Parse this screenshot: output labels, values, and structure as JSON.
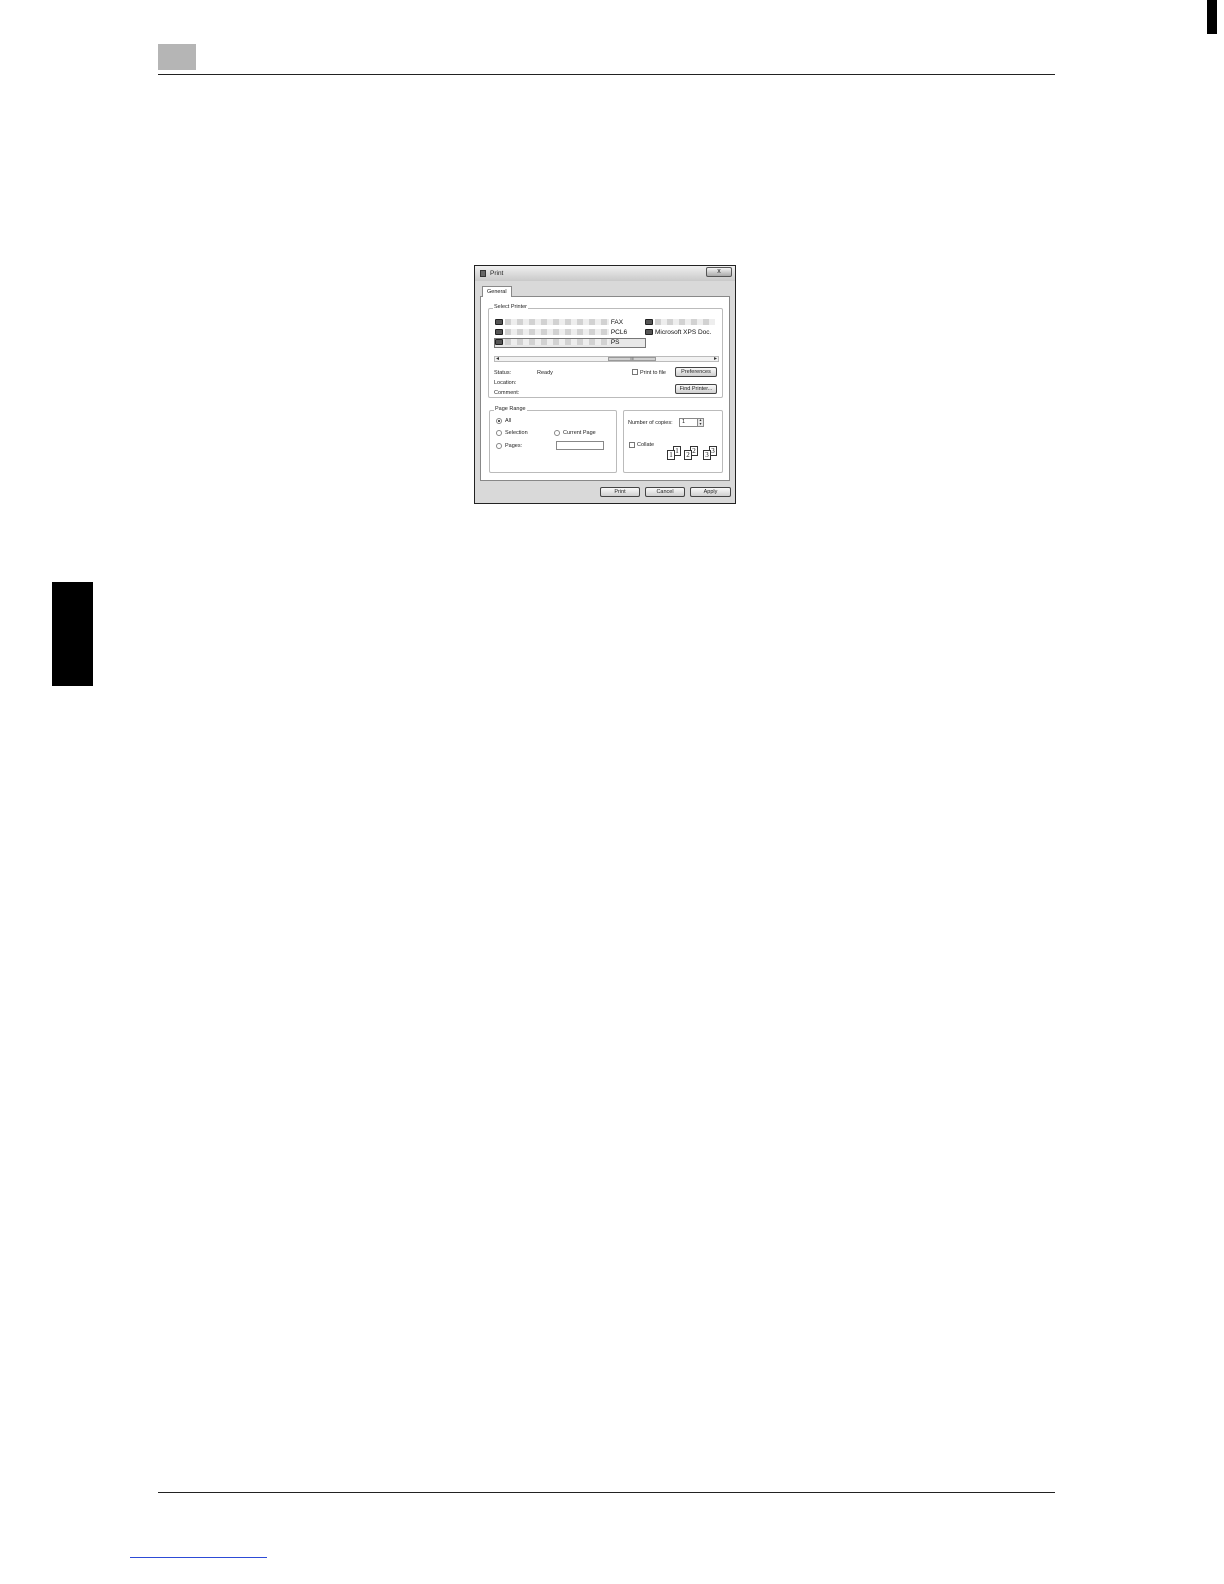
{
  "dialog": {
    "title": "Print",
    "close_glyph": "x",
    "tab": "General",
    "select_printer": {
      "legend": "Select Printer",
      "printers": [
        {
          "suffix": "FAX"
        },
        {
          "suffix": "PCL6"
        },
        {
          "suffix": "PS"
        },
        {
          "suffix": ""
        },
        {
          "suffix": "Microsoft XPS Doc."
        }
      ],
      "scroll_left": "◂",
      "scroll_right": "▸",
      "scroll_thumb": "III"
    },
    "status_label": "Status:",
    "status_value": "Ready",
    "location_label": "Location:",
    "comment_label": "Comment:",
    "print_to_file": "Print to file",
    "preferences_button": "Preferences",
    "find_printer_button": "Find Printer...",
    "page_range": {
      "legend": "Page Range",
      "all": "All",
      "selection": "Selection",
      "current_page": "Current Page",
      "pages": "Pages:"
    },
    "copies": {
      "label": "Number of copies:",
      "value": "1",
      "collate": "Collate",
      "spin_up": "▲",
      "spin_down": "▼",
      "collate_pages": [
        "1",
        "1",
        "2",
        "2",
        "3",
        "3"
      ]
    },
    "buttons": {
      "print": "Print",
      "cancel": "Cancel",
      "apply": "Apply"
    }
  }
}
